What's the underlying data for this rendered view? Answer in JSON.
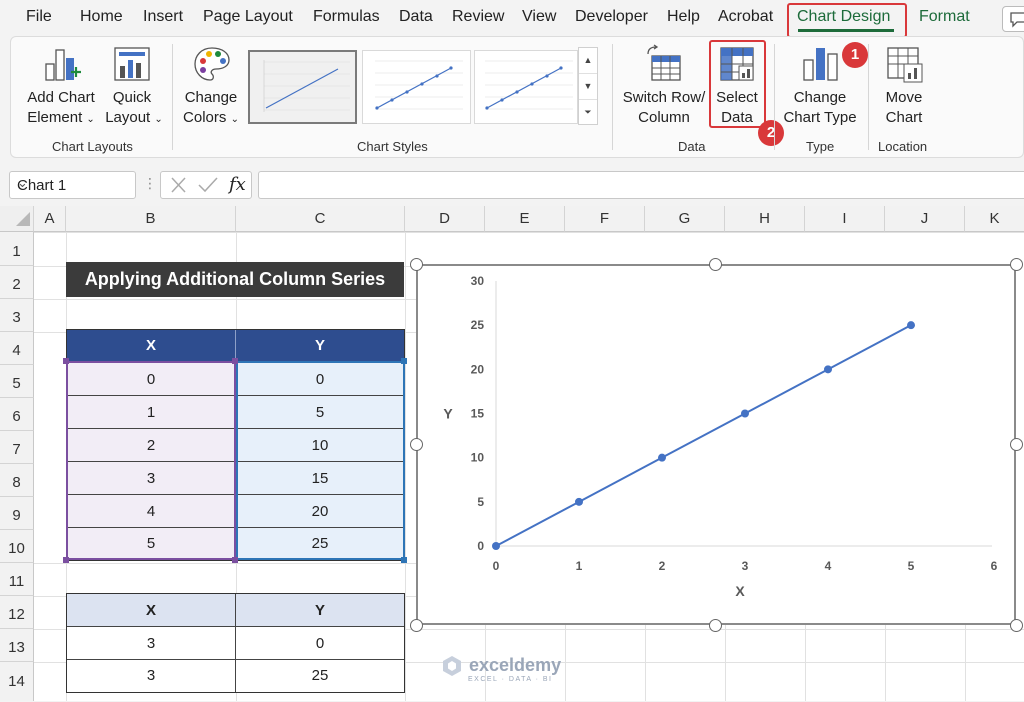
{
  "menu": {
    "items": [
      "File",
      "Home",
      "Insert",
      "Page Layout",
      "Formulas",
      "Data",
      "Review",
      "View",
      "Developer",
      "Help",
      "Acrobat",
      "Chart Design",
      "Format"
    ],
    "active": "Chart Design"
  },
  "ribbon": {
    "add_chart_element": [
      "Add Chart",
      "Element"
    ],
    "quick_layout": [
      "Quick",
      "Layout"
    ],
    "change_colors": [
      "Change",
      "Colors"
    ],
    "switch_row_column": [
      "Switch Row/",
      "Column"
    ],
    "select_data": [
      "Select",
      "Data"
    ],
    "change_chart_type": [
      "Change",
      "Chart Type"
    ],
    "move_chart": [
      "Move",
      "Chart"
    ],
    "groups": {
      "chart_layouts": "Chart Layouts",
      "chart_styles": "Chart Styles",
      "data": "Data",
      "type": "Type",
      "location": "Location"
    }
  },
  "annotations": {
    "badge1": "1",
    "badge2": "2"
  },
  "formula_bar": {
    "name_box": "Chart 1",
    "fx": "fx",
    "formula": ""
  },
  "columns": [
    "A",
    "B",
    "C",
    "D",
    "E",
    "F",
    "G",
    "H",
    "I",
    "J",
    "K"
  ],
  "rows": [
    "1",
    "2",
    "3",
    "4",
    "5",
    "6",
    "7",
    "8",
    "9",
    "10",
    "11",
    "12",
    "13",
    "14"
  ],
  "sheet": {
    "title": "Applying Additional Column Series",
    "table1": {
      "headers": [
        "X",
        "Y"
      ],
      "rows": [
        [
          "0",
          "0"
        ],
        [
          "1",
          "5"
        ],
        [
          "2",
          "10"
        ],
        [
          "3",
          "15"
        ],
        [
          "4",
          "20"
        ],
        [
          "5",
          "25"
        ]
      ]
    },
    "table2": {
      "headers": [
        "X",
        "Y"
      ],
      "rows": [
        [
          "3",
          "0"
        ],
        [
          "3",
          "25"
        ]
      ]
    }
  },
  "watermark": {
    "name": "exceldemy",
    "tagline": "EXCEL · DATA · BI"
  },
  "colors": {
    "accent_green": "#1d6b3a",
    "highlight_red": "#d9383a",
    "series_blue": "#4472c4",
    "header_navy": "#2e4d8f"
  },
  "chart_data": {
    "type": "scatter",
    "xlabel": "X",
    "ylabel": "Y",
    "xlim": [
      0,
      6
    ],
    "ylim": [
      0,
      30
    ],
    "xticks": [
      "0",
      "1",
      "2",
      "3",
      "4",
      "5",
      "6"
    ],
    "yticks": [
      "0",
      "5",
      "10",
      "15",
      "20",
      "25",
      "30"
    ],
    "series": [
      {
        "x": [
          0,
          1,
          2,
          3,
          4,
          5
        ],
        "y": [
          0,
          5,
          10,
          15,
          20,
          25
        ]
      }
    ],
    "grid": "horizontal-baseline-only",
    "legend": "none"
  }
}
